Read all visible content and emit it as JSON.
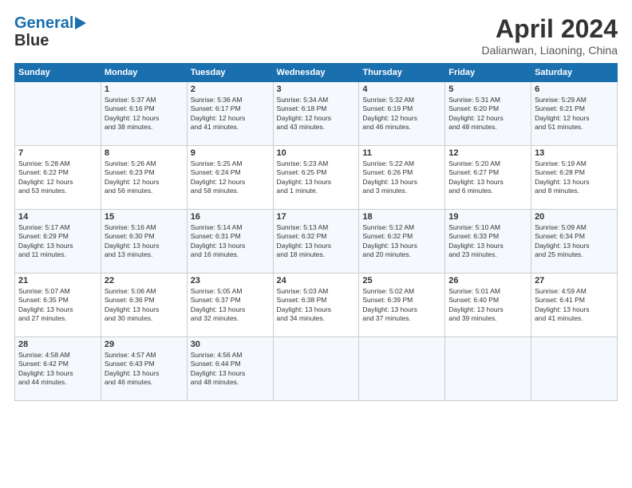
{
  "header": {
    "logo_line1": "General",
    "logo_line2": "Blue",
    "title": "April 2024",
    "location": "Dalianwan, Liaoning, China"
  },
  "days_of_week": [
    "Sunday",
    "Monday",
    "Tuesday",
    "Wednesday",
    "Thursday",
    "Friday",
    "Saturday"
  ],
  "weeks": [
    [
      {
        "day": "",
        "info": ""
      },
      {
        "day": "1",
        "info": "Sunrise: 5:37 AM\nSunset: 6:16 PM\nDaylight: 12 hours\nand 38 minutes."
      },
      {
        "day": "2",
        "info": "Sunrise: 5:36 AM\nSunset: 6:17 PM\nDaylight: 12 hours\nand 41 minutes."
      },
      {
        "day": "3",
        "info": "Sunrise: 5:34 AM\nSunset: 6:18 PM\nDaylight: 12 hours\nand 43 minutes."
      },
      {
        "day": "4",
        "info": "Sunrise: 5:32 AM\nSunset: 6:19 PM\nDaylight: 12 hours\nand 46 minutes."
      },
      {
        "day": "5",
        "info": "Sunrise: 5:31 AM\nSunset: 6:20 PM\nDaylight: 12 hours\nand 48 minutes."
      },
      {
        "day": "6",
        "info": "Sunrise: 5:29 AM\nSunset: 6:21 PM\nDaylight: 12 hours\nand 51 minutes."
      }
    ],
    [
      {
        "day": "7",
        "info": "Sunrise: 5:28 AM\nSunset: 6:22 PM\nDaylight: 12 hours\nand 53 minutes."
      },
      {
        "day": "8",
        "info": "Sunrise: 5:26 AM\nSunset: 6:23 PM\nDaylight: 12 hours\nand 56 minutes."
      },
      {
        "day": "9",
        "info": "Sunrise: 5:25 AM\nSunset: 6:24 PM\nDaylight: 12 hours\nand 58 minutes."
      },
      {
        "day": "10",
        "info": "Sunrise: 5:23 AM\nSunset: 6:25 PM\nDaylight: 13 hours\nand 1 minute."
      },
      {
        "day": "11",
        "info": "Sunrise: 5:22 AM\nSunset: 6:26 PM\nDaylight: 13 hours\nand 3 minutes."
      },
      {
        "day": "12",
        "info": "Sunrise: 5:20 AM\nSunset: 6:27 PM\nDaylight: 13 hours\nand 6 minutes."
      },
      {
        "day": "13",
        "info": "Sunrise: 5:19 AM\nSunset: 6:28 PM\nDaylight: 13 hours\nand 8 minutes."
      }
    ],
    [
      {
        "day": "14",
        "info": "Sunrise: 5:17 AM\nSunset: 6:29 PM\nDaylight: 13 hours\nand 11 minutes."
      },
      {
        "day": "15",
        "info": "Sunrise: 5:16 AM\nSunset: 6:30 PM\nDaylight: 13 hours\nand 13 minutes."
      },
      {
        "day": "16",
        "info": "Sunrise: 5:14 AM\nSunset: 6:31 PM\nDaylight: 13 hours\nand 16 minutes."
      },
      {
        "day": "17",
        "info": "Sunrise: 5:13 AM\nSunset: 6:32 PM\nDaylight: 13 hours\nand 18 minutes."
      },
      {
        "day": "18",
        "info": "Sunrise: 5:12 AM\nSunset: 6:32 PM\nDaylight: 13 hours\nand 20 minutes."
      },
      {
        "day": "19",
        "info": "Sunrise: 5:10 AM\nSunset: 6:33 PM\nDaylight: 13 hours\nand 23 minutes."
      },
      {
        "day": "20",
        "info": "Sunrise: 5:09 AM\nSunset: 6:34 PM\nDaylight: 13 hours\nand 25 minutes."
      }
    ],
    [
      {
        "day": "21",
        "info": "Sunrise: 5:07 AM\nSunset: 6:35 PM\nDaylight: 13 hours\nand 27 minutes."
      },
      {
        "day": "22",
        "info": "Sunrise: 5:06 AM\nSunset: 6:36 PM\nDaylight: 13 hours\nand 30 minutes."
      },
      {
        "day": "23",
        "info": "Sunrise: 5:05 AM\nSunset: 6:37 PM\nDaylight: 13 hours\nand 32 minutes."
      },
      {
        "day": "24",
        "info": "Sunrise: 5:03 AM\nSunset: 6:38 PM\nDaylight: 13 hours\nand 34 minutes."
      },
      {
        "day": "25",
        "info": "Sunrise: 5:02 AM\nSunset: 6:39 PM\nDaylight: 13 hours\nand 37 minutes."
      },
      {
        "day": "26",
        "info": "Sunrise: 5:01 AM\nSunset: 6:40 PM\nDaylight: 13 hours\nand 39 minutes."
      },
      {
        "day": "27",
        "info": "Sunrise: 4:59 AM\nSunset: 6:41 PM\nDaylight: 13 hours\nand 41 minutes."
      }
    ],
    [
      {
        "day": "28",
        "info": "Sunrise: 4:58 AM\nSunset: 6:42 PM\nDaylight: 13 hours\nand 44 minutes."
      },
      {
        "day": "29",
        "info": "Sunrise: 4:57 AM\nSunset: 6:43 PM\nDaylight: 13 hours\nand 46 minutes."
      },
      {
        "day": "30",
        "info": "Sunrise: 4:56 AM\nSunset: 6:44 PM\nDaylight: 13 hours\nand 48 minutes."
      },
      {
        "day": "",
        "info": ""
      },
      {
        "day": "",
        "info": ""
      },
      {
        "day": "",
        "info": ""
      },
      {
        "day": "",
        "info": ""
      }
    ]
  ]
}
